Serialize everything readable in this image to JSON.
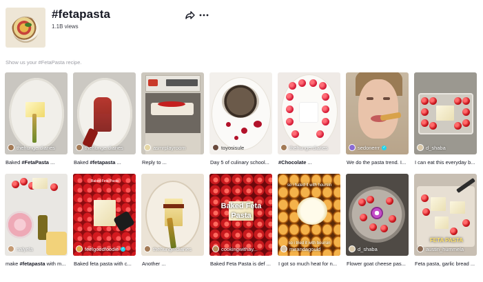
{
  "header": {
    "title": "#fetapasta",
    "views": "1.1B views",
    "share_icon": "share-arrow-icon",
    "more_icon": "ellipsis-icon"
  },
  "description": "Show us your #FetaPasta recipe.",
  "videos": [
    {
      "author": "thehungerdiaries",
      "caption_pre": "Baked ",
      "caption_tag": "#FetaPasta",
      "caption_post": " ...",
      "verified": false
    },
    {
      "author": "thehungerdiaries",
      "caption_pre": "Baked ",
      "caption_tag": "#fetapasta",
      "caption_post": " ...",
      "verified": false
    },
    {
      "author": "asmrplayroom",
      "caption_pre": "Reply to ...",
      "caption_tag": "",
      "caption_post": "",
      "verified": false
    },
    {
      "author": "toyosisule",
      "caption_pre": "Day 5 of culinary school...",
      "caption_tag": "",
      "caption_post": "",
      "verified": false
    },
    {
      "author": "thehungerdiaries",
      "caption_pre": "",
      "caption_tag": "#Chocolate",
      "caption_post": " ...",
      "verified": false
    },
    {
      "author": "sedonerrr",
      "caption_pre": "We do the pasta trend. I...",
      "caption_tag": "",
      "caption_post": "",
      "verified": true
    },
    {
      "author": "d_shaba",
      "caption_pre": "I can eat this everyday b...",
      "caption_tag": "",
      "caption_post": "",
      "verified": false
    },
    {
      "author": "nalyela",
      "caption_pre": "make ",
      "caption_tag": "#fetapasta",
      "caption_post": " with m...",
      "verified": false
    },
    {
      "author": "feelgoodfoodie",
      "caption_pre": "Baked feta pasta with c...",
      "caption_tag": "",
      "caption_post": "",
      "verified": true
    },
    {
      "author": "thehungerdiaries",
      "caption_pre": "Another ...",
      "caption_tag": "",
      "caption_post": "",
      "verified": false
    },
    {
      "author": "cookingwithay...",
      "caption_pre": "Baked Feta Pasta is def ...",
      "caption_tag": "",
      "caption_post": "",
      "verified": false
    },
    {
      "author": "mirandagould",
      "caption_pre": "I got so much heat for n...",
      "caption_tag": "",
      "caption_post": "",
      "verified": false
    },
    {
      "author": "d_shaba",
      "caption_pre": "Flower goat cheese pas...",
      "caption_tag": "",
      "caption_post": "",
      "verified": false
    },
    {
      "author": "austin_hummela",
      "caption_pre": "Feta pasta, garlic bread ...",
      "caption_tag": "",
      "caption_post": "",
      "verified": false
    }
  ],
  "overlays": {
    "v2_label": "Baked Feta Pasta",
    "v11_title": "Baked Feta Pasta",
    "v12_top": "so i hated it with hoursin",
    "v12_bottom": "so i tried it with boursin",
    "v14_label": "FETA PASTA"
  }
}
